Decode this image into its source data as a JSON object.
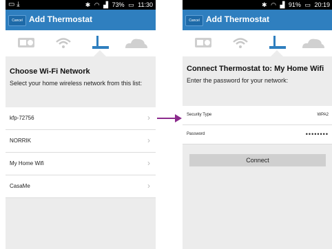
{
  "left": {
    "status": {
      "battery": "73%",
      "time": "11:30"
    },
    "cancel_label": "Cancel",
    "title": "Add Thermostat",
    "heading": "Choose Wi-Fi Network",
    "subtext": "Select your home wireless network from this list:",
    "networks": [
      "kfp-72756",
      "NORRIK",
      "My Home Wifi",
      "CasaMe"
    ]
  },
  "right": {
    "status": {
      "battery": "91%",
      "time": "20:19"
    },
    "cancel_label": "Cancel",
    "title": "Add Thermostat",
    "heading": "Connect Thermostat to: My Home Wifi",
    "subtext": "Enter the password for your network:",
    "security_type_label": "Security Type",
    "security_type_value": "WPA2",
    "password_label": "Password",
    "password_value": "••••••••",
    "connect_label": "Connect"
  },
  "steps": [
    "thermostat-icon",
    "wifi-icon",
    "router-icon",
    "cloud-icon"
  ],
  "colors": {
    "titlebar": "#2f7fbf",
    "active_step": "#2f7fbf",
    "inactive_step": "#c8c8c8",
    "arrow": "#8b2a8c"
  }
}
